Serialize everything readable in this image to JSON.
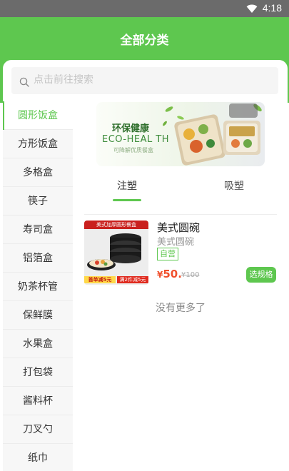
{
  "status_bar": {
    "time": "4:18",
    "wifi_icon": "wifi-icon"
  },
  "header": {
    "title": "全部分类"
  },
  "search": {
    "placeholder": "点击前往搜索",
    "icon": "search-icon"
  },
  "sidebar": {
    "items": [
      {
        "label": "圆形饭盒",
        "active": true
      },
      {
        "label": "方形饭盒"
      },
      {
        "label": "多格盒"
      },
      {
        "label": "筷子"
      },
      {
        "label": "寿司盒"
      },
      {
        "label": "铝箔盒"
      },
      {
        "label": "奶茶杯管"
      },
      {
        "label": "保鲜膜"
      },
      {
        "label": "水果盒"
      },
      {
        "label": "打包袋"
      },
      {
        "label": "酱料杯"
      },
      {
        "label": "刀叉勺"
      },
      {
        "label": "纸巾"
      }
    ]
  },
  "banner": {
    "title": "环保健康",
    "subtitle": "ECO-HEAL TH",
    "caption": "可降解优质餐盒"
  },
  "tabs": [
    {
      "label": "注塑",
      "active": true
    },
    {
      "label": "吸塑"
    }
  ],
  "product": {
    "name": "美式圆碗",
    "subtitle": "美式圆碗",
    "tag": "自营",
    "price_symbol": "¥",
    "price": "50.",
    "old_price": "¥100",
    "button": "选规格",
    "image_texts": {
      "top_label": "美式加厚圆形餐盒",
      "badge_left": "首单减5元",
      "badge_right": "满2件减5元"
    }
  },
  "footer_text": "没有更多了",
  "colors": {
    "primary": "#5ec74f",
    "price": "#f0502d",
    "status_bar": "#6b6b6b"
  }
}
